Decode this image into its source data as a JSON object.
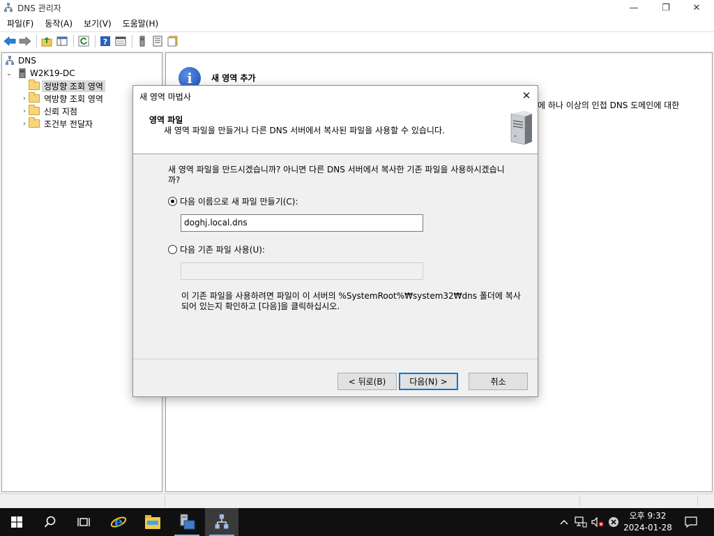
{
  "window": {
    "title": "DNS 관리자",
    "minimize_label": "—",
    "maximize_label": "❐",
    "close_label": "✕"
  },
  "menu": [
    "파일(F)",
    "동작(A)",
    "보기(V)",
    "도움말(H)"
  ],
  "toolbar_icons": [
    "back-icon",
    "forward-icon",
    "up-folder-icon",
    "show-hide-tree-icon",
    "refresh-icon",
    "help-icon",
    "properties-icon",
    "server-icon",
    "list-icon",
    "zone-icon"
  ],
  "tree": {
    "root": "DNS",
    "server": "W2K19-DC",
    "items": [
      {
        "label": "정방향 조회 영역",
        "selected": true
      },
      {
        "label": "역방향 조회 영역",
        "selected": false
      },
      {
        "label": "신뢰 지점",
        "selected": false
      },
      {
        "label": "조건부 전달자",
        "selected": false
      }
    ]
  },
  "right_pane": {
    "heading": "새 영역 추가",
    "text_partial": "에 하나 이상의 인접 DNS 도메인에 대한"
  },
  "dialog": {
    "title": "새 영역 마법사",
    "close_label": "✕",
    "header_title": "영역 파일",
    "header_subtitle": "새 영역 파일을 만들거나 다른 DNS 서버에서 복사된 파일을 사용할 수 있습니다.",
    "question": "새 영역 파일을 만드시겠습니까? 아니면 다른 DNS 서버에서 복사한 기존 파일을 사용하시겠습니까?",
    "option_create_label": "다음 이름으로 새 파일 만들기(C):",
    "option_create_value": "doghj.local.dns",
    "option_existing_label": "다음 기존 파일 사용(U):",
    "option_existing_value": "",
    "note": "이 기존 파일을 사용하려면 파일이 이 서버의 %SystemRoot%₩system32₩dns 폴더에 복사되어 있는지 확인하고 [다음]을 클릭하십시오.",
    "buttons": {
      "back": "< 뒤로(B)",
      "next": "다음(N) >",
      "cancel": "취소"
    }
  },
  "taskbar": {
    "clock_time": "오후 9:32",
    "clock_date": "2024-01-28",
    "apps": [
      "start-icon",
      "search-icon",
      "task-view-icon",
      "internet-explorer-icon",
      "file-explorer-icon",
      "server-manager-icon",
      "dns-manager-icon"
    ],
    "tray_icons": [
      "chevron-up-icon",
      "network-icon",
      "volume-muted-icon",
      "error-icon",
      "notification-icon"
    ]
  },
  "colors": {
    "accent": "#0078d7",
    "taskbar": "#101010",
    "dialog_bg": "#f0f0f0"
  }
}
